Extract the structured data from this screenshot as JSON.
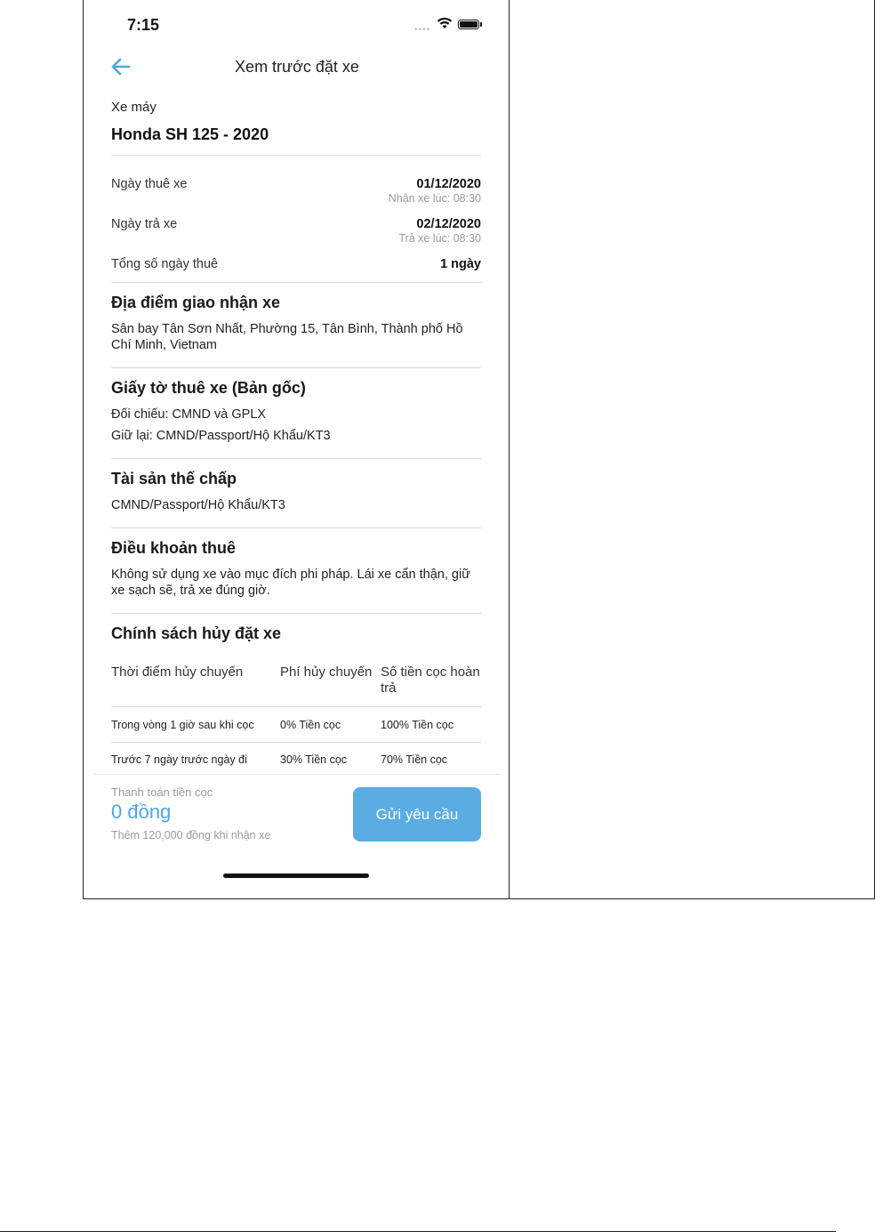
{
  "status": {
    "time": "7:15"
  },
  "header": {
    "title": "Xem trước đặt xe"
  },
  "vehicle": {
    "type_label": "Xe máy",
    "name": "Honda SH 125 - 2020"
  },
  "dates": [
    {
      "label": "Ngày thuê xe",
      "value": "01/12/2020",
      "sub": "Nhận xe lúc: 08:30"
    },
    {
      "label": "Ngày trả xe",
      "value": "02/12/2020",
      "sub": "Trả xe lúc: 08:30"
    },
    {
      "label": "Tổng số ngày thuê",
      "value": "1 ngày"
    }
  ],
  "location": {
    "heading": "Địa điểm giao nhận xe",
    "text": "Sân bay Tân Sơn Nhất, Phường 15, Tân Bình, Thành phố Hồ Chí Minh, Vietnam"
  },
  "documents": {
    "heading": "Giấy tờ thuê xe (Bản gốc)",
    "check": "Đối chiếu: CMND và GPLX",
    "keep": "Giữ lại: CMND/Passport/Hộ Khẩu/KT3"
  },
  "collateral": {
    "heading": "Tài sản thế chấp",
    "text": "CMND/Passport/Hộ Khẩu/KT3"
  },
  "terms": {
    "heading": "Điều khoản thuê",
    "text": "Không sử dụng xe vào mục đích phi pháp. Lái xe cẩn thận, giữ xe sạch sẽ, trả xe đúng giờ."
  },
  "policy": {
    "heading": "Chính sách hủy đặt xe",
    "columns": [
      "Thời điểm hủy chuyến",
      "Phí hủy chuyến",
      "Số tiền cọc hoàn trả"
    ],
    "rows": [
      [
        "Trong vòng 1 giờ sau khi cọc",
        "0% Tiền cọc",
        "100% Tiền cọc"
      ],
      [
        "Trước 7 ngày trước ngày đi",
        "30% Tiền cọc",
        "70% Tiền cọc"
      ]
    ]
  },
  "payment": {
    "label": "Thanh toán tiền cọc",
    "value": "0 đồng",
    "extra": "Thêm 120,000 đồng khi nhận xe",
    "submit_label": "Gửi yêu cầu"
  },
  "colors": {
    "accent": "#4da6e8",
    "button": "#5aace3"
  }
}
